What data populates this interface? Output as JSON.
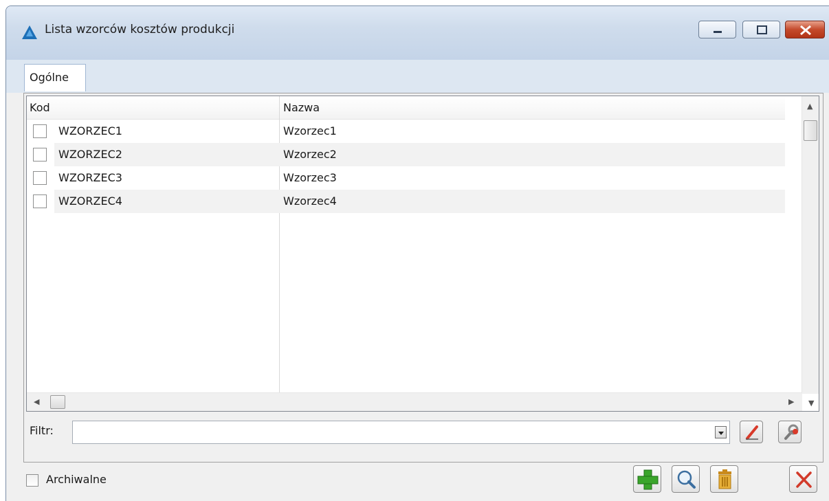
{
  "window": {
    "title": "Lista wzorców kosztów produkcji"
  },
  "tabs": [
    {
      "label": "Ogólne"
    }
  ],
  "grid": {
    "columns": [
      "Kod",
      "Nazwa"
    ],
    "rows": [
      {
        "kod": "WZORZEC1",
        "nazwa": "Wzorzec1",
        "checked": false
      },
      {
        "kod": "WZORZEC2",
        "nazwa": "Wzorzec2",
        "checked": false
      },
      {
        "kod": "WZORZEC3",
        "nazwa": "Wzorzec3",
        "checked": false
      },
      {
        "kod": "WZORZEC4",
        "nazwa": "Wzorzec4",
        "checked": false
      }
    ]
  },
  "filter": {
    "label": "Filtr:",
    "value": ""
  },
  "archiwalne": {
    "label": "Archiwalne",
    "checked": false
  },
  "icons": {
    "app": "triangle-logo-icon",
    "add": "plus-icon",
    "view": "magnifier-icon",
    "delete": "trash-icon",
    "close": "close-icon",
    "clear_filter": "eraser-icon",
    "filter_tools": "wrench-icon"
  },
  "colors": {
    "accent": "#1e6fb8",
    "add_green": "#3aa52b",
    "close_red": "#d23a2a"
  }
}
